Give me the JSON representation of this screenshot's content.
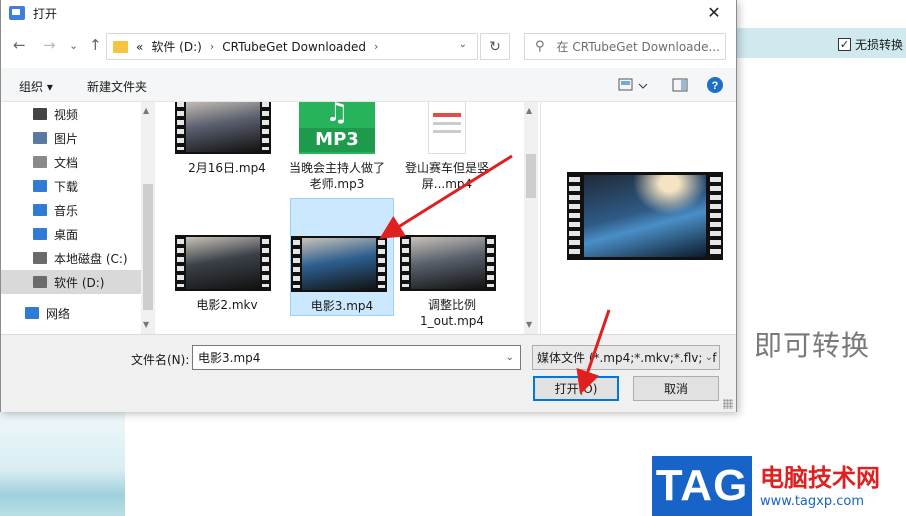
{
  "dialog": {
    "title": "打开",
    "close_glyph": "✕"
  },
  "nav": {
    "back": "←",
    "forward": "→",
    "recent": "⌄",
    "up": "↑",
    "crumbs": [
      "«",
      "软件 (D:)",
      "CRTubeGet Downloaded"
    ],
    "crumb_sep": "›",
    "dropdown": "⌄",
    "refresh": "↻",
    "search_placeholder": "在 CRTubeGet Downloade..."
  },
  "toolbar": {
    "organize": "组织",
    "new_folder": "新建文件夹",
    "help": "?"
  },
  "sidebar": {
    "items": [
      {
        "label": "视频",
        "icon": "video-icon",
        "color": "#444444"
      },
      {
        "label": "图片",
        "icon": "picture-icon",
        "color": "#5b7aa3"
      },
      {
        "label": "文档",
        "icon": "document-icon",
        "color": "#8a8a8a"
      },
      {
        "label": "下载",
        "icon": "download-icon",
        "color": "#2f7bd6"
      },
      {
        "label": "音乐",
        "icon": "music-icon",
        "color": "#2f7bd6"
      },
      {
        "label": "桌面",
        "icon": "desktop-icon",
        "color": "#2f7bd6"
      },
      {
        "label": "本地磁盘 (C:)",
        "icon": "drive-icon",
        "color": "#6b6b6b"
      },
      {
        "label": "软件 (D:)",
        "icon": "drive-icon",
        "color": "#6b6b6b",
        "selected": true
      },
      {
        "label": "网络",
        "icon": "network-icon",
        "color": "#2f7bd6"
      }
    ]
  },
  "files": [
    {
      "name": "2月16日.mp4",
      "kind": "video",
      "frame": "#5a5f6e"
    },
    {
      "name": "当晚会主持人做了老师.mp3",
      "kind": "audio"
    },
    {
      "name": "登山赛车但是竖屏...mp4",
      "kind": "doc"
    },
    {
      "name": "电影2.mkv",
      "kind": "video",
      "frame": "#3b4149"
    },
    {
      "name": "电影3.mp4",
      "kind": "video",
      "frame": "#2d5f8e",
      "selected": true
    },
    {
      "name": "调整比例1_out.mp4",
      "kind": "video",
      "frame": "#58606b"
    }
  ],
  "audio_badge": "MP3",
  "bottom": {
    "filename_label": "文件名(N):",
    "filename_value": "电影3.mp4",
    "filter": "媒体文件 (*.mp4;*.mkv;*.flv;*.f",
    "open_button": "打开(O)",
    "cancel_button": "取消"
  },
  "background": {
    "checkbox_label": "无损转换",
    "checkbox_mark": "✓",
    "convert_text": "即可转换"
  },
  "watermark": {
    "brand": "TAG",
    "site_name": "电脑技术网",
    "url": "www.tagxp.com"
  },
  "colors": {
    "accent": "#0078d7",
    "selection": "#cce8ff",
    "arrow": "#e02020",
    "watermark_blue": "#1763c7"
  }
}
